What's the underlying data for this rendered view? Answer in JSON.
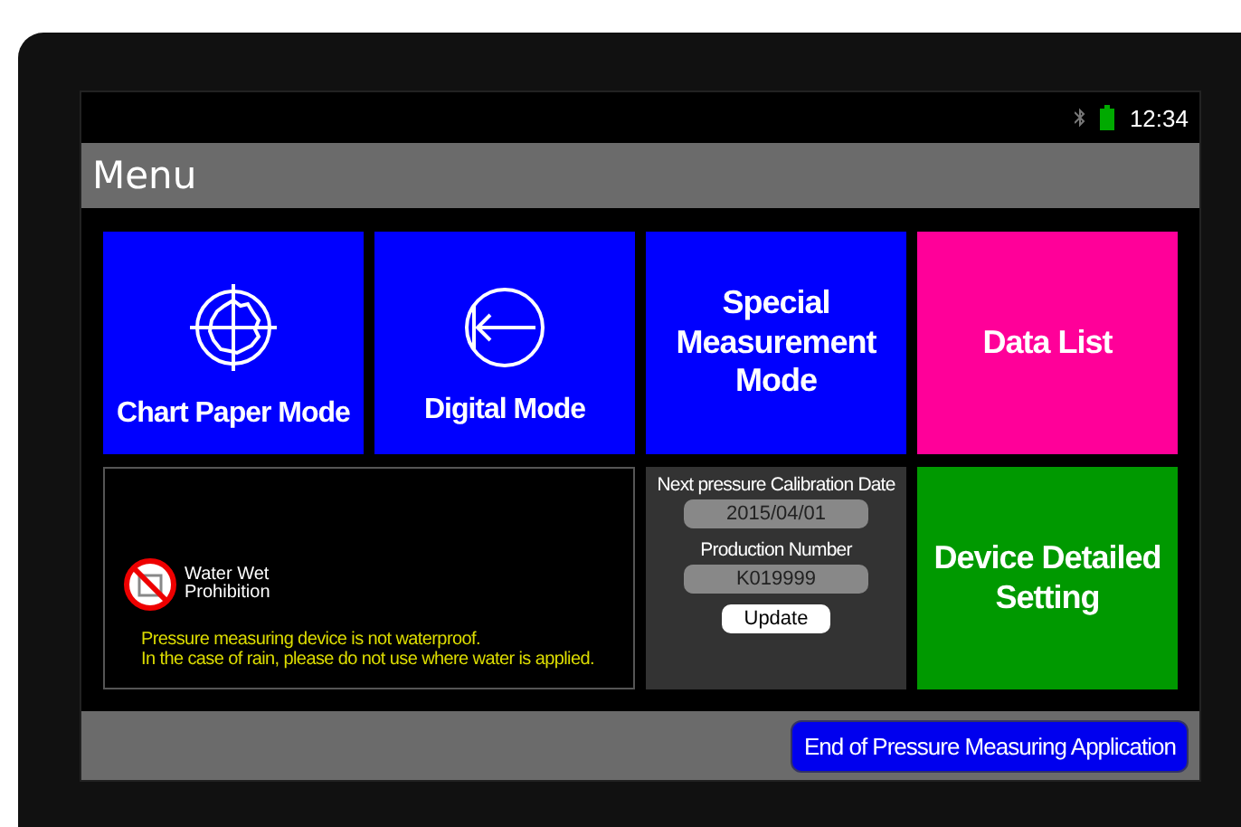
{
  "status_bar": {
    "time": "12:34"
  },
  "title": "Menu",
  "tiles": [
    {
      "kind": "chart",
      "label": "Chart Paper Mode",
      "color": "#0000ff"
    },
    {
      "kind": "digital",
      "label": "Digital Mode",
      "color": "#0000ff"
    },
    {
      "kind": "text",
      "label": "Special Measurement Mode",
      "color": "#0000ff"
    },
    {
      "kind": "text",
      "label": "Data List",
      "color": "#ff0099"
    }
  ],
  "notice": {
    "sign": "Water Wet Prohibition",
    "lines": [
      "Pressure measuring device is not waterproof.",
      "In the case of rain, please do not use where water is applied."
    ]
  },
  "info": {
    "calibration_label": "Next pressure Calibration Date",
    "calibration_value": "2015/04/01",
    "production_label": "Production Number",
    "production_value": "K019999",
    "button": "Update"
  },
  "settings_tile": {
    "label": "Device Detailed Setting",
    "color": "#009900"
  },
  "end_button": "End of Pressure Measuring Application"
}
